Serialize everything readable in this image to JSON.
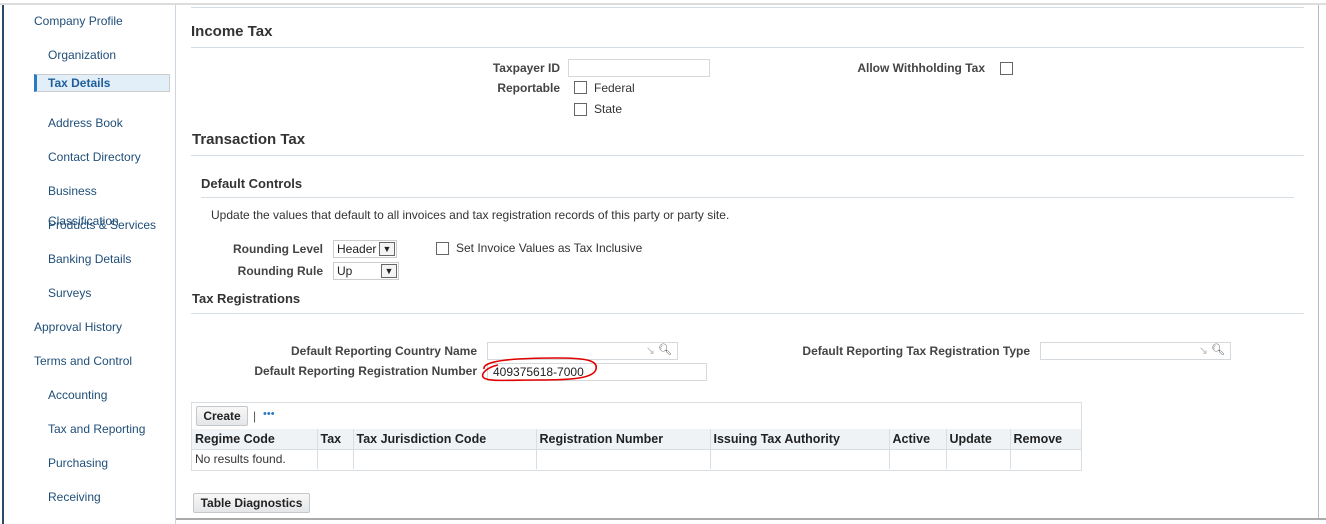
{
  "sidebar": {
    "items": [
      {
        "label": "Company Profile",
        "level": 0
      },
      {
        "label": "Organization",
        "level": 1
      },
      {
        "label": "Tax Details",
        "level": 1,
        "selected": true
      },
      {
        "label": "Address Book",
        "level": 1
      },
      {
        "label": "Contact Directory",
        "level": 1
      },
      {
        "label": "Business Classification",
        "level": 1
      },
      {
        "label": "Products & Services",
        "level": 1
      },
      {
        "label": "Banking Details",
        "level": 1
      },
      {
        "label": "Surveys",
        "level": 1
      },
      {
        "label": "Approval History",
        "level": 0
      },
      {
        "label": "Terms and Control",
        "level": 0
      },
      {
        "label": "Accounting",
        "level": 1
      },
      {
        "label": "Tax and Reporting",
        "level": 1
      },
      {
        "label": "Purchasing",
        "level": 1
      },
      {
        "label": "Receiving",
        "level": 1
      }
    ]
  },
  "income_tax": {
    "title": "Income Tax",
    "taxpayer_id_label": "Taxpayer ID",
    "taxpayer_id_value": "",
    "reportable_label": "Reportable",
    "federal_label": "Federal",
    "state_label": "State",
    "allow_withholding_label": "Allow Withholding Tax"
  },
  "transaction_tax": {
    "title": "Transaction Tax",
    "default_controls_title": "Default Controls",
    "description": "Update the values that default to all invoices and tax registration records of this party or party site.",
    "rounding_level_label": "Rounding Level",
    "rounding_level_value": "Header",
    "rounding_rule_label": "Rounding Rule",
    "rounding_rule_value": "Up",
    "tax_inclusive_label": "Set Invoice Values as Tax Inclusive"
  },
  "tax_registrations": {
    "title": "Tax Registrations",
    "country_label": "Default Reporting Country Name",
    "country_value": "",
    "reg_type_label": "Default Reporting Tax Registration Type",
    "reg_type_value": "",
    "reg_number_label": "Default Reporting Registration Number",
    "reg_number_value": "409375618-7000",
    "annotation_color": "#e00000",
    "create_label": "Create",
    "separator": "|",
    "more_label": "•••",
    "columns": [
      "Regime Code",
      "Tax",
      "Tax Jurisdiction Code",
      "Registration Number",
      "Issuing Tax Authority",
      "Active",
      "Update",
      "Remove"
    ],
    "empty_text": "No results found.",
    "diagnostics_label": "Table Diagnostics"
  }
}
